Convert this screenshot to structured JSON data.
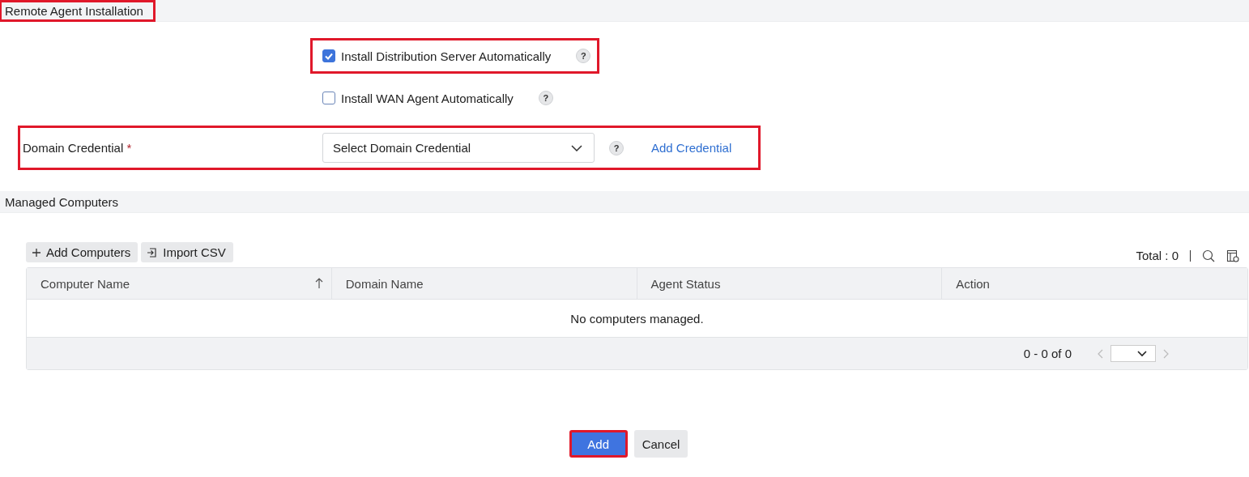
{
  "install_section": {
    "title": "Remote Agent Installation",
    "highlighted": true
  },
  "options": [
    {
      "label": "Install Distribution Server Automatically",
      "checked": true,
      "highlighted": true,
      "help": "?"
    },
    {
      "label": "Install WAN Agent Automatically",
      "checked": false,
      "highlighted": false,
      "help": "?"
    }
  ],
  "credential": {
    "label": "Domain Credential",
    "required_mark": "*",
    "help": "?",
    "placeholder": "Select Domain Credential",
    "link": "Add Credential",
    "highlighted": true
  },
  "computers_section": {
    "title": "Managed Computers"
  },
  "toolbar": {
    "buttons": [
      {
        "kind": "add",
        "label": "Add Computers"
      },
      {
        "kind": "import",
        "label": "Import CSV"
      }
    ],
    "total": "Total : 0"
  },
  "table": {
    "columns": [
      {
        "label": "Computer Name",
        "sorted": true
      },
      {
        "label": "Domain Name",
        "sorted": false
      },
      {
        "label": "Agent Status",
        "sorted": false
      },
      {
        "label": "Action",
        "sorted": false
      }
    ],
    "empty_message": "No computers managed.",
    "pagination": "0 - 0 of 0"
  },
  "actions": [
    {
      "kind": "primary",
      "label": "Add",
      "highlighted": true
    },
    {
      "kind": "secondary",
      "label": "Cancel",
      "highlighted": false
    }
  ]
}
